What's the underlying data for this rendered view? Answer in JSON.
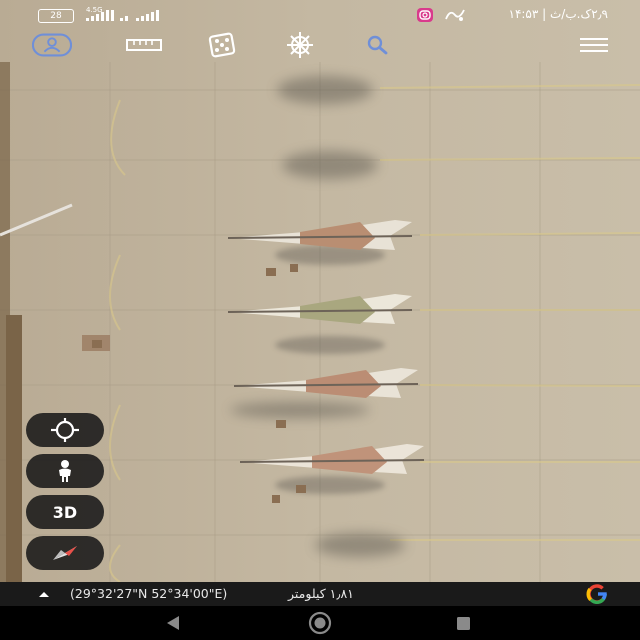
{
  "status_bar": {
    "battery": "28",
    "network": "4.5G",
    "time_date": "۲٫۹ک.ب/ث | ۱۴:۵۳"
  },
  "toolbar": {
    "items": [
      {
        "name": "account",
        "icon": "user-circle-icon"
      },
      {
        "name": "measure",
        "icon": "ruler-icon"
      },
      {
        "name": "random",
        "icon": "dice-icon"
      },
      {
        "name": "voyager",
        "icon": "ship-wheel-icon"
      },
      {
        "name": "search",
        "icon": "search-icon"
      },
      {
        "name": "menu",
        "icon": "hamburger-menu-icon"
      }
    ]
  },
  "map_controls": {
    "my_location": {
      "icon": "crosshair-icon"
    },
    "street_view": {
      "icon": "pegman-icon"
    },
    "view_3d": {
      "label": "3D"
    },
    "compass": {
      "icon": "compass-needle-icon"
    }
  },
  "bottom_bar": {
    "coordinates": "(29°32'27\"N 52°34'00\"E)",
    "scale": "۱٫۸۱ کیلومتر",
    "logo": "G"
  },
  "colors": {
    "accent_blue": "#6f8fd8",
    "tarmac": "#c2b59e",
    "logo_blue": "#4285F4",
    "logo_red": "#EA4335",
    "logo_yellow": "#FBBC05",
    "logo_green": "#34A853"
  }
}
